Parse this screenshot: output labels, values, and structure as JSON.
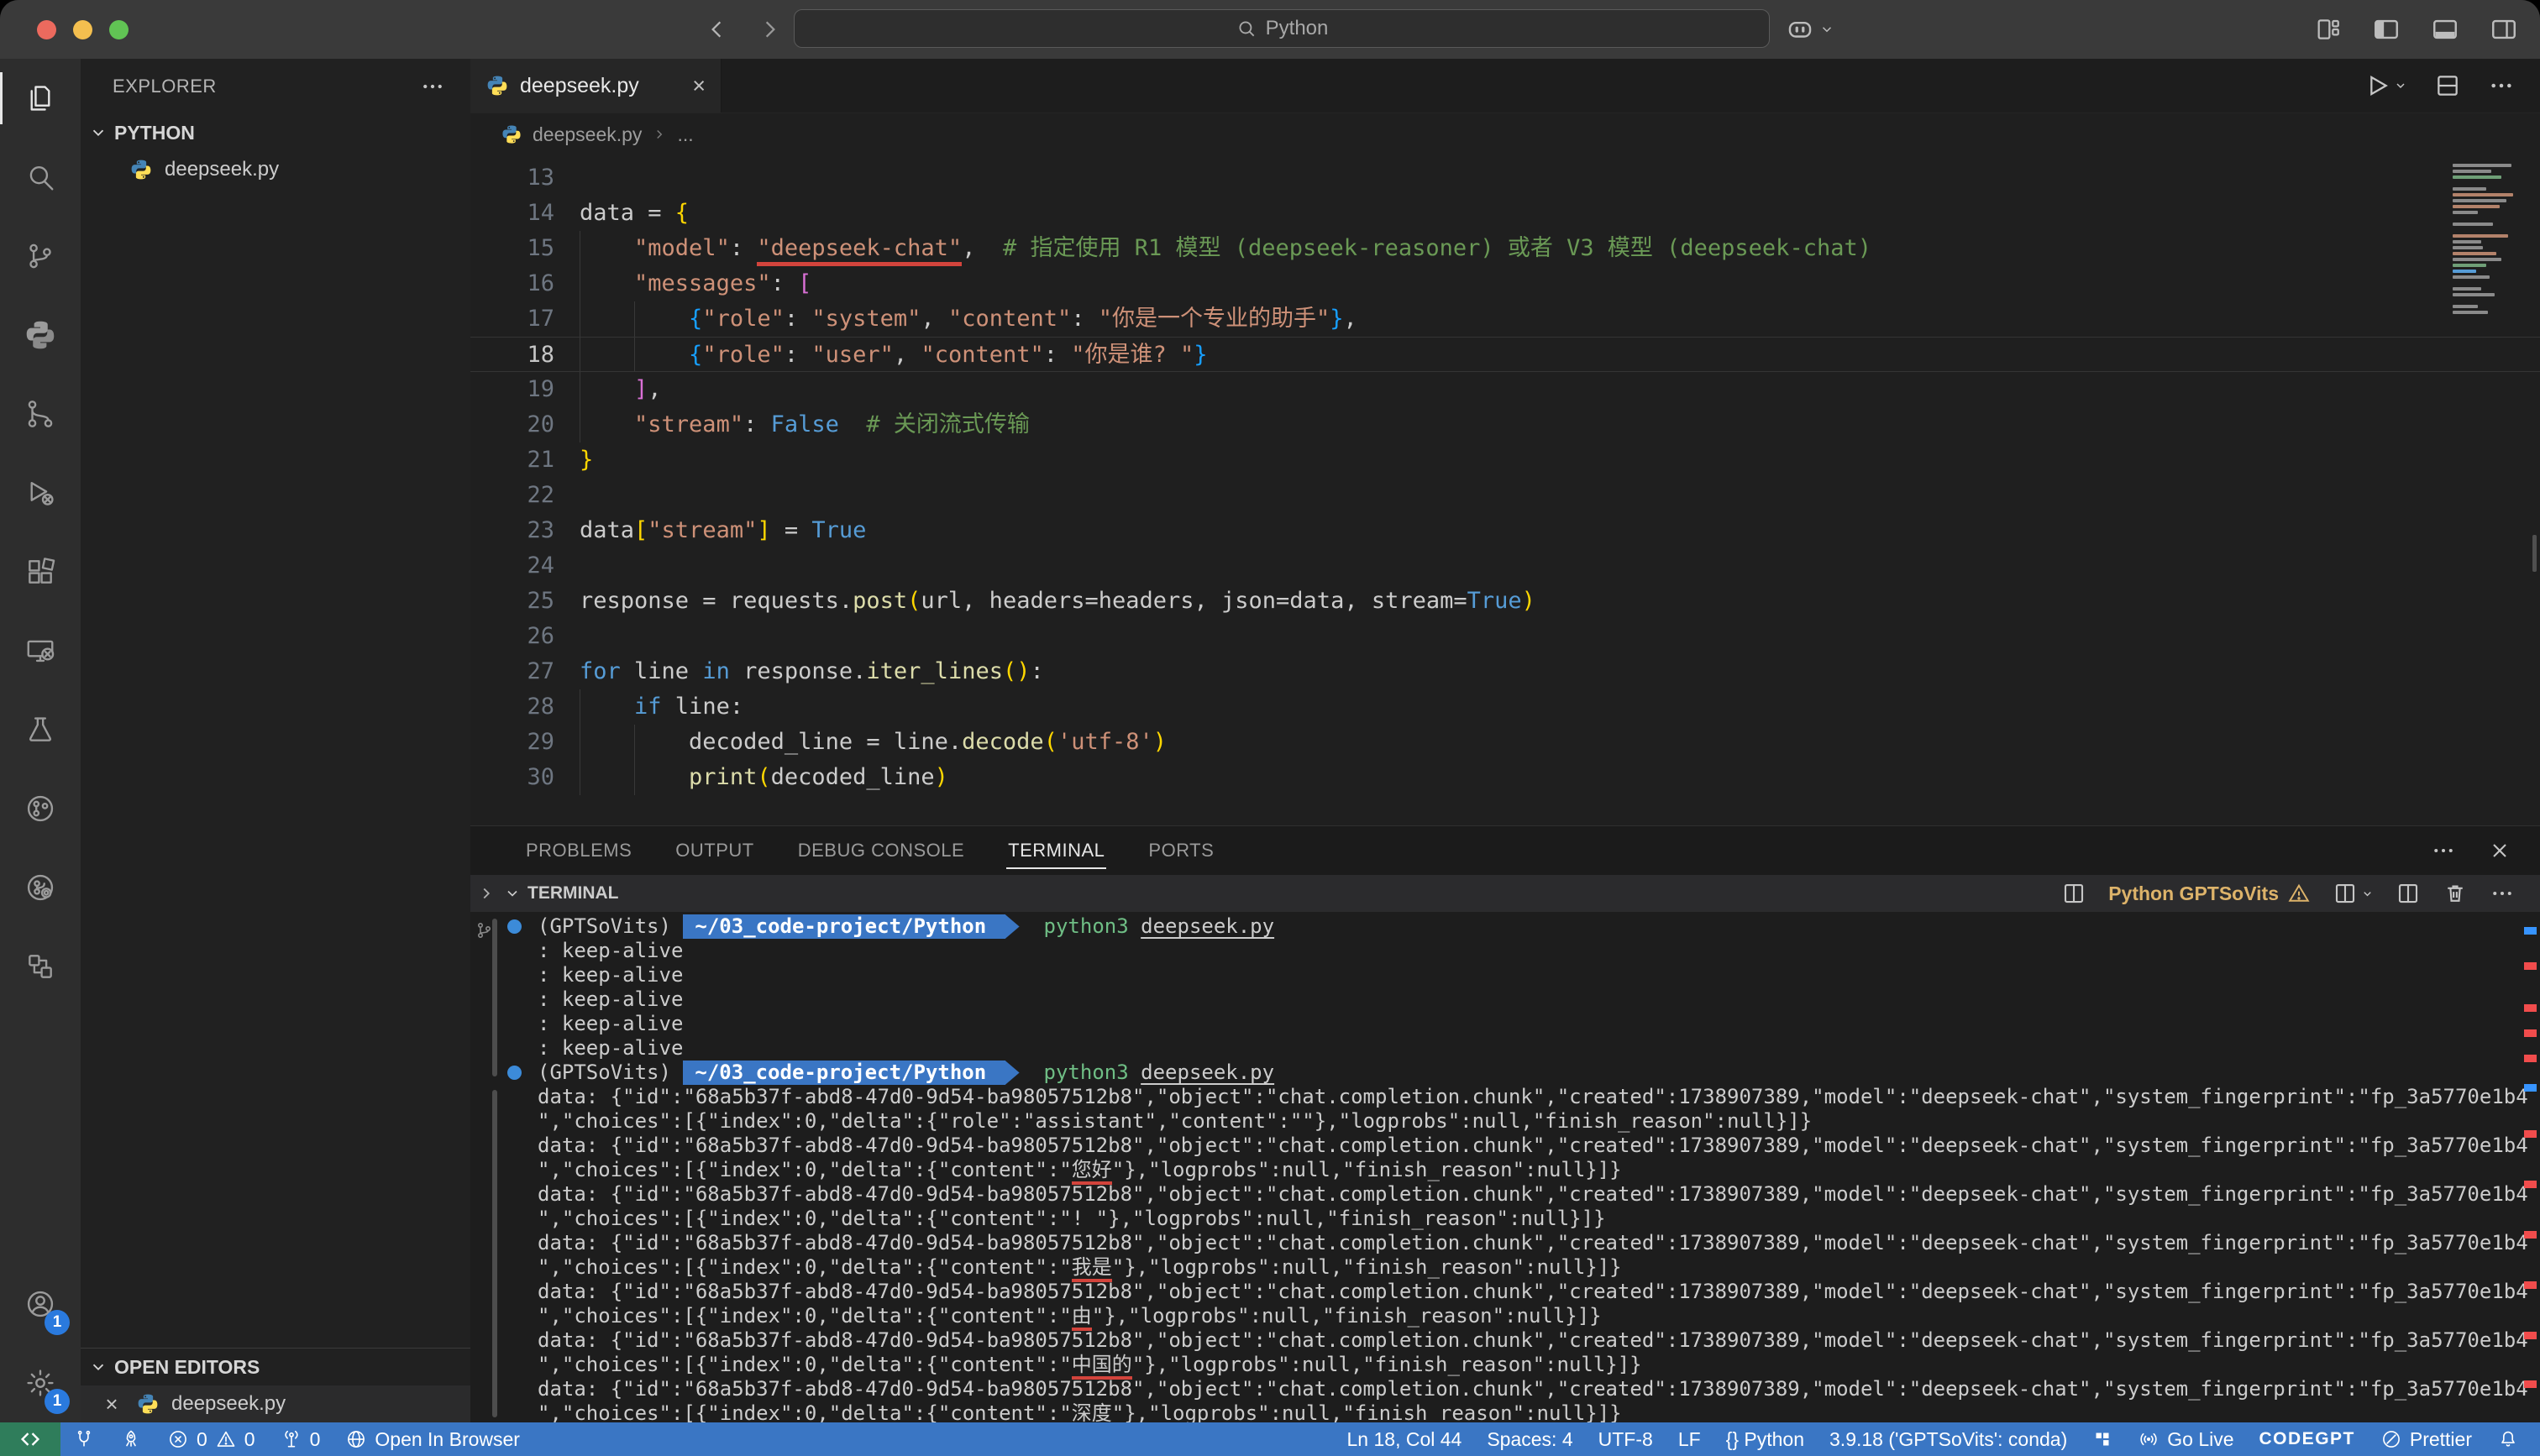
{
  "titlebar": {
    "search_value": "Python"
  },
  "activity_bar": {
    "top_items": [
      {
        "name": "explorer",
        "active": true
      },
      {
        "name": "search"
      },
      {
        "name": "source-control"
      },
      {
        "name": "python"
      },
      {
        "name": "git-graph"
      },
      {
        "name": "run-debug"
      },
      {
        "name": "extensions"
      },
      {
        "name": "remote-explorer"
      },
      {
        "name": "testing"
      },
      {
        "name": "circle-branch"
      },
      {
        "name": "code-stream"
      },
      {
        "name": "organization"
      }
    ],
    "bottom_items": [
      {
        "name": "accounts",
        "badge": "1"
      },
      {
        "name": "settings",
        "badge": "1"
      }
    ]
  },
  "sidebar": {
    "title": "EXPLORER",
    "section_label": "PYTHON",
    "file_label": "deepseek.py",
    "open_editors_label": "OPEN EDITORS",
    "open_editor_file": "deepseek.py"
  },
  "editor": {
    "tab_label": "deepseek.py",
    "breadcrumb_file": "deepseek.py",
    "breadcrumb_more": "...",
    "code": {
      "language": "python",
      "lines": [
        {
          "num": "13",
          "tokens": []
        },
        {
          "num": "14",
          "tokens": [
            [
              "t",
              "data = "
            ],
            [
              "b1",
              "{"
            ]
          ]
        },
        {
          "num": "15",
          "guides": [
            0
          ],
          "tokens": [
            [
              "t",
              "    "
            ],
            [
              "s",
              "\"model\""
            ],
            [
              "t",
              ": "
            ],
            [
              "su",
              "\"deepseek-chat\""
            ],
            [
              "t",
              ",  "
            ],
            [
              "c",
              "# 指定使用 R1 模型 (deepseek-reasoner) 或者 V3 模型 (deepseek-chat)"
            ]
          ]
        },
        {
          "num": "16",
          "guides": [
            0
          ],
          "tokens": [
            [
              "t",
              "    "
            ],
            [
              "s",
              "\"messages\""
            ],
            [
              "t",
              ": "
            ],
            [
              "b2",
              "["
            ]
          ]
        },
        {
          "num": "17",
          "guides": [
            0,
            4
          ],
          "tokens": [
            [
              "t",
              "        "
            ],
            [
              "b3",
              "{"
            ],
            [
              "s",
              "\"role\""
            ],
            [
              "t",
              ": "
            ],
            [
              "s",
              "\"system\""
            ],
            [
              "t",
              ", "
            ],
            [
              "s",
              "\"content\""
            ],
            [
              "t",
              ": "
            ],
            [
              "s",
              "\"你是一个专业的助手\""
            ],
            [
              "b3",
              "}"
            ],
            [
              "t",
              ","
            ]
          ]
        },
        {
          "num": "18",
          "current": true,
          "guides": [
            0,
            4
          ],
          "tokens": [
            [
              "t",
              "        "
            ],
            [
              "b3",
              "{"
            ],
            [
              "s",
              "\"role\""
            ],
            [
              "t",
              ": "
            ],
            [
              "s",
              "\"user\""
            ],
            [
              "t",
              ", "
            ],
            [
              "s",
              "\"content\""
            ],
            [
              "t",
              ": "
            ],
            [
              "s",
              "\"你是谁? \""
            ],
            [
              "b3",
              "}"
            ]
          ]
        },
        {
          "num": "19",
          "guides": [
            0
          ],
          "tokens": [
            [
              "t",
              "    "
            ],
            [
              "b2",
              "]"
            ],
            [
              "t",
              ","
            ]
          ]
        },
        {
          "num": "20",
          "guides": [
            0
          ],
          "tokens": [
            [
              "t",
              "    "
            ],
            [
              "s",
              "\"stream\""
            ],
            [
              "t",
              ": "
            ],
            [
              "k",
              "False"
            ],
            [
              "t",
              "  "
            ],
            [
              "c",
              "# 关闭流式传输"
            ]
          ]
        },
        {
          "num": "21",
          "tokens": [
            [
              "b1",
              "}"
            ]
          ]
        },
        {
          "num": "22",
          "tokens": []
        },
        {
          "num": "23",
          "tokens": [
            [
              "t",
              "data"
            ],
            [
              "b1",
              "["
            ],
            [
              "s",
              "\"stream\""
            ],
            [
              "b1",
              "]"
            ],
            [
              "t",
              " = "
            ],
            [
              "k",
              "True"
            ]
          ]
        },
        {
          "num": "24",
          "tokens": []
        },
        {
          "num": "25",
          "tokens": [
            [
              "t",
              "response = requests."
            ],
            [
              "f",
              "post"
            ],
            [
              "b1",
              "("
            ],
            [
              "t",
              "url, headers=headers, json=data, stream="
            ],
            [
              "k",
              "True"
            ],
            [
              "b1",
              ")"
            ]
          ]
        },
        {
          "num": "26",
          "tokens": []
        },
        {
          "num": "27",
          "tokens": [
            [
              "k",
              "for"
            ],
            [
              "t",
              " line "
            ],
            [
              "k",
              "in"
            ],
            [
              "t",
              " response."
            ],
            [
              "f",
              "iter_lines"
            ],
            [
              "b1",
              "()"
            ],
            [
              "t",
              ":"
            ]
          ]
        },
        {
          "num": "28",
          "guides": [
            0
          ],
          "tokens": [
            [
              "t",
              "    "
            ],
            [
              "k",
              "if"
            ],
            [
              "t",
              " line:"
            ]
          ]
        },
        {
          "num": "29",
          "guides": [
            0,
            4
          ],
          "tokens": [
            [
              "t",
              "        decoded_line = line."
            ],
            [
              "f",
              "decode"
            ],
            [
              "b1",
              "("
            ],
            [
              "s",
              "'utf-8'"
            ],
            [
              "b1",
              ")"
            ]
          ]
        },
        {
          "num": "30",
          "guides": [
            0,
            4
          ],
          "tokens": [
            [
              "t",
              "        "
            ],
            [
              "f",
              "print"
            ],
            [
              "b1",
              "("
            ],
            [
              "t",
              "decoded_line"
            ],
            [
              "b1",
              ")"
            ]
          ]
        }
      ]
    }
  },
  "panel": {
    "tabs": [
      {
        "label": "PROBLEMS"
      },
      {
        "label": "OUTPUT"
      },
      {
        "label": "DEBUG CONSOLE"
      },
      {
        "label": "TERMINAL",
        "active": true
      },
      {
        "label": "PORTS"
      }
    ],
    "section_label": "TERMINAL",
    "terminal_name": "Python GPTSoVits"
  },
  "terminal": {
    "lines": [
      {
        "tokens": [
          [
            "dot",
            ""
          ],
          [
            "t",
            "(GPTSoVits) "
          ],
          [
            "pl",
            "~/03_code-project/Python "
          ],
          [
            "arrow",
            ""
          ],
          [
            "t",
            "  "
          ],
          [
            "g",
            "python3"
          ],
          [
            "t",
            " "
          ],
          [
            "u",
            "deepseek.py"
          ]
        ]
      },
      {
        "tokens": [
          [
            "t",
            ": keep-alive"
          ]
        ]
      },
      {
        "tokens": [
          [
            "t",
            ": keep-alive"
          ]
        ]
      },
      {
        "tokens": [
          [
            "t",
            ": keep-alive"
          ]
        ]
      },
      {
        "tokens": [
          [
            "t",
            ": keep-alive"
          ]
        ]
      },
      {
        "tokens": [
          [
            "t",
            ": keep-alive"
          ]
        ]
      },
      {
        "tokens": [
          [
            "dot",
            ""
          ],
          [
            "t",
            "(GPTSoVits) "
          ],
          [
            "pl",
            "~/03_code-project/Python "
          ],
          [
            "arrow",
            ""
          ],
          [
            "t",
            "  "
          ],
          [
            "g",
            "python3"
          ],
          [
            "t",
            " "
          ],
          [
            "u",
            "deepseek.py"
          ]
        ]
      },
      {
        "tokens": [
          [
            "t",
            "data: {\"id\":\"68a5b37f-abd8-47d0-9d54-ba98057512b8\",\"object\":\"chat.completion.chunk\",\"created\":1738907389,\"model\":\"deepseek-chat\",\"system_fingerprint\":\"fp_3a5770e1b4"
          ]
        ]
      },
      {
        "tokens": [
          [
            "t",
            "\",\"choices\":[{\"index\":0,\"delta\":{\"role\":\"assistant\",\"content\":\"\"},\"logprobs\":null,\"finish_reason\":null}]}"
          ]
        ]
      },
      {
        "tokens": [
          [
            "t",
            "data: {\"id\":\"68a5b37f-abd8-47d0-9d54-ba98057512b8\",\"object\":\"chat.completion.chunk\",\"created\":1738907389,\"model\":\"deepseek-chat\",\"system_fingerprint\":\"fp_3a5770e1b4"
          ]
        ]
      },
      {
        "tokens": [
          [
            "t",
            "\",\"choices\":[{\"index\":0,\"delta\":{\"content\":\""
          ],
          [
            "ru",
            "您好"
          ],
          [
            "t",
            "\"},\"logprobs\":null,\"finish_reason\":null}]}"
          ]
        ]
      },
      {
        "tokens": [
          [
            "t",
            "data: {\"id\":\"68a5b37f-abd8-47d0-9d54-ba98057512b8\",\"object\":\"chat.completion.chunk\",\"created\":1738907389,\"model\":\"deepseek-chat\",\"system_fingerprint\":\"fp_3a5770e1b4"
          ]
        ]
      },
      {
        "tokens": [
          [
            "t",
            "\",\"choices\":[{\"index\":0,\"delta\":{\"content\":\"! \"},\"logprobs\":null,\"finish_reason\":null}]}"
          ]
        ]
      },
      {
        "tokens": [
          [
            "t",
            "data: {\"id\":\"68a5b37f-abd8-47d0-9d54-ba98057512b8\",\"object\":\"chat.completion.chunk\",\"created\":1738907389,\"model\":\"deepseek-chat\",\"system_fingerprint\":\"fp_3a5770e1b4"
          ]
        ]
      },
      {
        "tokens": [
          [
            "t",
            "\",\"choices\":[{\"index\":0,\"delta\":{\"content\":\""
          ],
          [
            "ru",
            "我是"
          ],
          [
            "t",
            "\"},\"logprobs\":null,\"finish_reason\":null}]}"
          ]
        ]
      },
      {
        "tokens": [
          [
            "t",
            "data: {\"id\":\"68a5b37f-abd8-47d0-9d54-ba98057512b8\",\"object\":\"chat.completion.chunk\",\"created\":1738907389,\"model\":\"deepseek-chat\",\"system_fingerprint\":\"fp_3a5770e1b4"
          ]
        ]
      },
      {
        "tokens": [
          [
            "t",
            "\",\"choices\":[{\"index\":0,\"delta\":{\"content\":\""
          ],
          [
            "ru",
            "由"
          ],
          [
            "t",
            "\"},\"logprobs\":null,\"finish_reason\":null}]}"
          ]
        ]
      },
      {
        "tokens": [
          [
            "t",
            "data: {\"id\":\"68a5b37f-abd8-47d0-9d54-ba98057512b8\",\"object\":\"chat.completion.chunk\",\"created\":1738907389,\"model\":\"deepseek-chat\",\"system_fingerprint\":\"fp_3a5770e1b4"
          ]
        ]
      },
      {
        "tokens": [
          [
            "t",
            "\",\"choices\":[{\"index\":0,\"delta\":{\"content\":\""
          ],
          [
            "ru",
            "中国的"
          ],
          [
            "t",
            "\"},\"logprobs\":null,\"finish_reason\":null}]}"
          ]
        ]
      },
      {
        "tokens": [
          [
            "t",
            "data: {\"id\":\"68a5b37f-abd8-47d0-9d54-ba98057512b8\",\"object\":\"chat.completion.chunk\",\"created\":1738907389,\"model\":\"deepseek-chat\",\"system_fingerprint\":\"fp_3a5770e1b4"
          ]
        ]
      },
      {
        "tokens": [
          [
            "t",
            "\",\"choices\":[{\"index\":0,\"delta\":{\"content\":\""
          ],
          [
            "ru",
            "深度"
          ],
          [
            "t",
            "\"},\"logprobs\":null,\"finish_reason\":null}]}"
          ]
        ]
      }
    ]
  },
  "status_bar": {
    "left": [
      {
        "name": "tunnel",
        "parts": [
          [
            "icon",
            "plug"
          ]
        ]
      },
      {
        "name": "codegpt-rocket",
        "parts": [
          [
            "icon",
            "rocket"
          ]
        ]
      },
      {
        "name": "problems",
        "parts": [
          [
            "icon",
            "error"
          ],
          [
            "text",
            "0"
          ],
          [
            "icon",
            "warning"
          ],
          [
            "text",
            "0"
          ]
        ]
      },
      {
        "name": "forwarded-ports",
        "parts": [
          [
            "icon",
            "tower"
          ],
          [
            "text",
            "0"
          ]
        ]
      },
      {
        "name": "open-in-browser",
        "parts": [
          [
            "icon",
            "globe"
          ],
          [
            "text",
            "Open In Browser"
          ]
        ]
      }
    ],
    "right": [
      {
        "name": "cursor-position",
        "parts": [
          [
            "text",
            "Ln 18, Col 44"
          ]
        ]
      },
      {
        "name": "indentation",
        "parts": [
          [
            "text",
            "Spaces: 4"
          ]
        ]
      },
      {
        "name": "encoding",
        "parts": [
          [
            "text",
            "UTF-8"
          ]
        ]
      },
      {
        "name": "eol",
        "parts": [
          [
            "text",
            "LF"
          ]
        ]
      },
      {
        "name": "language-mode",
        "parts": [
          [
            "text",
            "{} Python"
          ]
        ]
      },
      {
        "name": "python-interpreter",
        "parts": [
          [
            "text",
            "3.9.18 ('GPTSoVits': conda)"
          ]
        ]
      },
      {
        "name": "extension-blocks",
        "parts": [
          [
            "icon",
            "blocks"
          ]
        ]
      },
      {
        "name": "go-live",
        "parts": [
          [
            "icon",
            "broadcast"
          ],
          [
            "text",
            "Go Live"
          ]
        ]
      },
      {
        "name": "codegpt",
        "parts": [
          [
            "btext",
            "CODEGPT"
          ]
        ]
      },
      {
        "name": "prettier",
        "parts": [
          [
            "icon",
            "slash"
          ],
          [
            "text",
            "Prettier"
          ]
        ]
      },
      {
        "name": "notifications",
        "parts": [
          [
            "icon",
            "bell"
          ]
        ]
      }
    ]
  },
  "colors": {
    "accent_blue": "#3a76c4",
    "remote_green": "#2f7d5b",
    "terminal_name_yellow": "#ddb36a",
    "error_red": "#d3443c",
    "string_orange": "#ce9178",
    "comment_green": "#6a9955",
    "keyword_blue": "#569cd6"
  }
}
